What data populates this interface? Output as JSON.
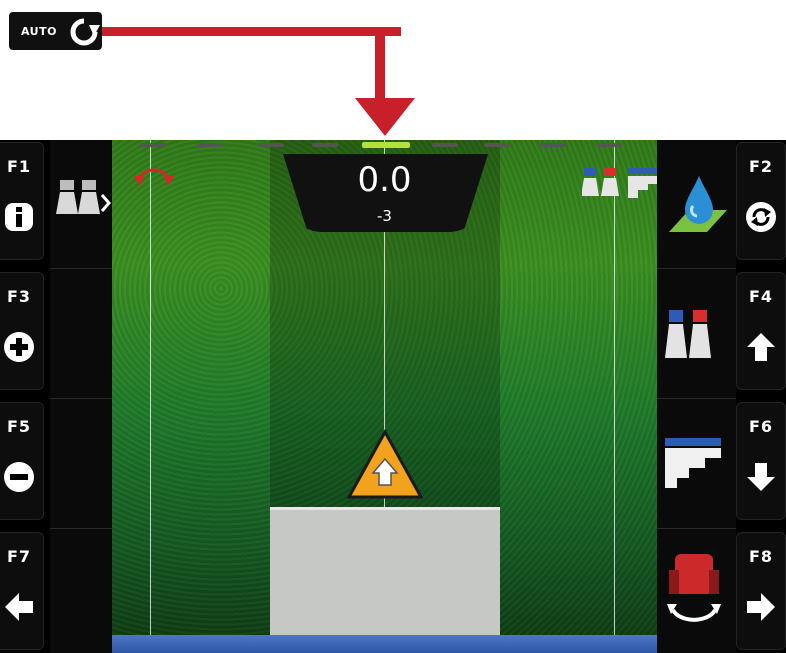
{
  "auto_button": {
    "label": "AUTO",
    "icon": "refresh-circle-icon"
  },
  "annotation_color": "#c8202a",
  "display": {
    "readout": {
      "value": "0.0",
      "sub_value": "-3"
    },
    "active_segment_color": "#b5e23a",
    "warning_icon": "triangle-up-arrow-icon",
    "left_keys": [
      {
        "label": "F1",
        "icon": "info-icon"
      },
      {
        "label": "F3",
        "icon": "plus-circle-icon"
      },
      {
        "label": "F5",
        "icon": "minus-circle-icon"
      },
      {
        "label": "F7",
        "icon": "arrow-left-icon"
      }
    ],
    "right_keys": [
      {
        "label": "F2",
        "icon": "refresh-circle-icon"
      },
      {
        "label": "F4",
        "icon": "arrow-up-icon"
      },
      {
        "label": "F6",
        "icon": "arrow-down-icon"
      },
      {
        "label": "F8",
        "icon": "arrow-right-icon"
      }
    ],
    "panel_icons": [
      "nozzle-icon",
      "water-drop-icon",
      "blue-red-nozzle-icon",
      "stair-profile-icon",
      "machine-rotate-icon"
    ]
  }
}
